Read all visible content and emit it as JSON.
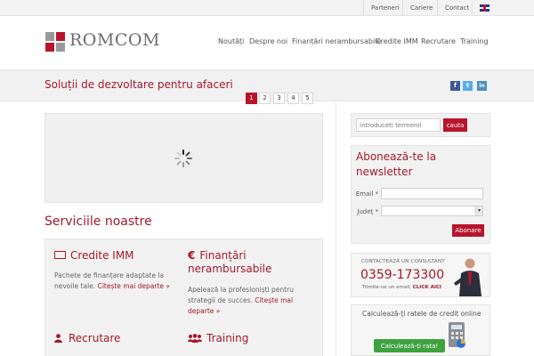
{
  "topbar": {
    "links": [
      "Parteneri",
      "Cariere",
      "Contact"
    ],
    "language_icon": "uk-flag-icon"
  },
  "header": {
    "logo_text": "ROMCOM",
    "nav": [
      "Noutăți",
      "Despre noi",
      "Finanțări nerambursabile",
      "Credite IMM",
      "Recrutare",
      "Training"
    ]
  },
  "band": {
    "slogan": "Soluții de dezvoltare pentru afaceri",
    "social": [
      {
        "label": "f",
        "icon": "facebook-icon",
        "color": "#3b5998"
      },
      {
        "label": "t",
        "icon": "twitter-icon",
        "color": "#55acee"
      },
      {
        "label": "in",
        "icon": "linkedin-icon",
        "color": "#4a90c2"
      }
    ]
  },
  "slider": {
    "pages": [
      "1",
      "2",
      "3",
      "4",
      "5"
    ],
    "active_page": "1",
    "loading_icon": "spinner-icon"
  },
  "services": {
    "title": "Serviciile noastre",
    "items": [
      {
        "title": "Credite IMM",
        "icon": "money-icon",
        "text": "Pachete de finanțare adaptate la nevoile tale.",
        "more": "Citește mai departe »"
      },
      {
        "title": "Finanțări nerambursabile",
        "icon": "euro-icon",
        "text": "Apelează la profesioniști pentru strategii de succes.",
        "more": "Citește mai departe »"
      },
      {
        "title": "Recrutare",
        "icon": "user-icon"
      },
      {
        "title": "Training",
        "icon": "group-icon"
      }
    ]
  },
  "sidebar": {
    "search": {
      "placeholder": "introduceti termenii",
      "button": "cauta"
    },
    "newsletter": {
      "title_line1": "Abonează-te la",
      "title_line2": "newsletter",
      "email_label": "Email *",
      "county_label": "Județ *",
      "button": "Abonare"
    },
    "consultant": {
      "heading": "CONTACTEAZĂ UN CONSULTANT",
      "phone": "0359-173300",
      "note": "Trimite-ne un email,",
      "note_link": "CLICK AICI"
    },
    "calculator": {
      "title": "Calculează-ți ratele de credit online",
      "button": "Calculează-ți rata!"
    }
  },
  "colors": {
    "accent": "#b8152c",
    "band": "#f1f1f1",
    "calc_button": "#3ea23e"
  }
}
